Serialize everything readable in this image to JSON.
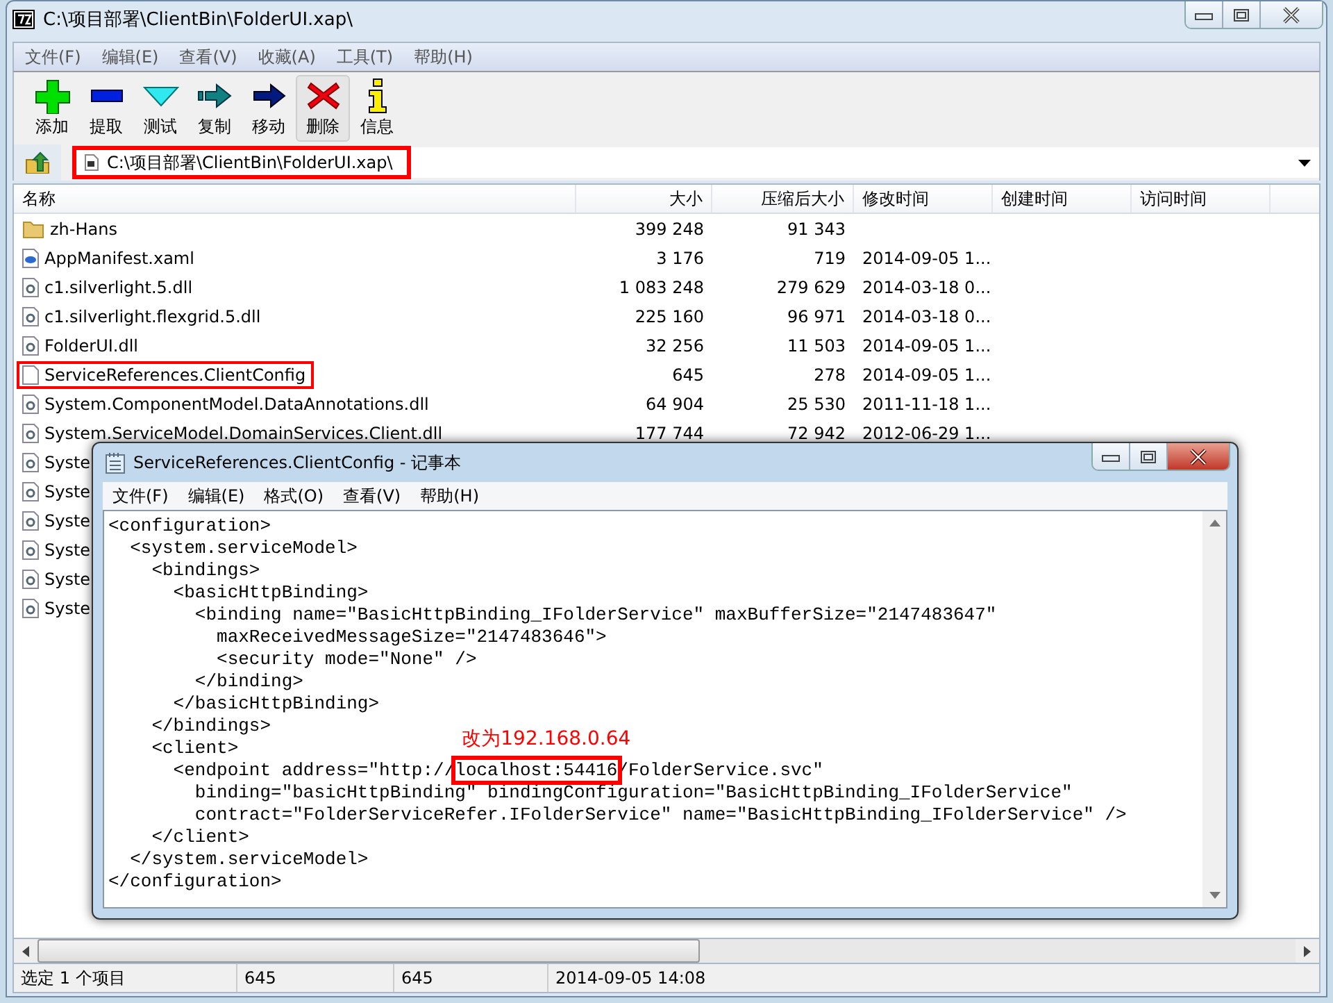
{
  "window": {
    "title": "C:\\项目部署\\ClientBin\\FolderUI.xap\\"
  },
  "menu": [
    "文件(F)",
    "编辑(E)",
    "查看(V)",
    "收藏(A)",
    "工具(T)",
    "帮助(H)"
  ],
  "toolbar": [
    {
      "kind": "add",
      "label": "添加",
      "hot": false
    },
    {
      "kind": "extract",
      "label": "提取",
      "hot": false
    },
    {
      "kind": "test",
      "label": "测试",
      "hot": false
    },
    {
      "kind": "copy",
      "label": "复制",
      "hot": false
    },
    {
      "kind": "move",
      "label": "移动",
      "hot": false
    },
    {
      "kind": "delete",
      "label": "删除",
      "hot": true
    },
    {
      "kind": "info",
      "label": "信息",
      "hot": false
    }
  ],
  "address": {
    "value": "C:\\项目部署\\ClientBin\\FolderUI.xap\\",
    "marked": true
  },
  "table": {
    "columns": [
      "名称",
      "大小",
      "压缩后大小",
      "修改时间",
      "创建时间",
      "访问时间"
    ],
    "rows": [
      {
        "kind": "folder",
        "name": "zh-Hans",
        "size": "399 248",
        "packed": "91 343",
        "modified": "",
        "marked": false
      },
      {
        "kind": "xaml",
        "name": "AppManifest.xaml",
        "size": "3 176",
        "packed": "719",
        "modified": "2014-09-05 1...",
        "marked": false
      },
      {
        "kind": "dll",
        "name": "c1.silverlight.5.dll",
        "size": "1 083 248",
        "packed": "279 629",
        "modified": "2014-03-18 0...",
        "marked": false
      },
      {
        "kind": "dll",
        "name": "c1.silverlight.flexgrid.5.dll",
        "size": "225 160",
        "packed": "96 971",
        "modified": "2014-03-18 0...",
        "marked": false
      },
      {
        "kind": "dll",
        "name": "FolderUI.dll",
        "size": "32 256",
        "packed": "11 503",
        "modified": "2014-09-05 1...",
        "marked": false
      },
      {
        "kind": "file",
        "name": "ServiceReferences.ClientConfig",
        "size": "645",
        "packed": "278",
        "modified": "2014-09-05 1...",
        "marked": true
      },
      {
        "kind": "dll",
        "name": "System.ComponentModel.DataAnnotations.dll",
        "size": "64 904",
        "packed": "25 530",
        "modified": "2011-11-18 1...",
        "marked": false
      },
      {
        "kind": "dll",
        "name": "System.ServiceModel.DomainServices.Client.dll",
        "size": "177 744",
        "packed": "72 942",
        "modified": "2012-06-29 1...",
        "marked": false
      },
      {
        "kind": "dll",
        "name": "Syste",
        "size": "",
        "packed": "",
        "modified": "",
        "marked": false
      },
      {
        "kind": "dll",
        "name": "Syste",
        "size": "",
        "packed": "",
        "modified": "",
        "marked": false
      },
      {
        "kind": "dll",
        "name": "Syste",
        "size": "",
        "packed": "",
        "modified": "",
        "marked": false
      },
      {
        "kind": "dll",
        "name": "Syste",
        "size": "",
        "packed": "",
        "modified": "",
        "marked": false
      },
      {
        "kind": "dll",
        "name": "Syste",
        "size": "",
        "packed": "",
        "modified": "",
        "marked": false
      },
      {
        "kind": "dll",
        "name": "Syste",
        "size": "",
        "packed": "",
        "modified": "",
        "marked": false
      }
    ]
  },
  "status_bar": [
    "选定 1 个项目",
    "645",
    "645",
    "2014-09-05 14:08"
  ],
  "notepad": {
    "title": "ServiceReferences.ClientConfig - 记事本",
    "menu": [
      "文件(F)",
      "编辑(E)",
      "格式(O)",
      "查看(V)",
      "帮助(H)"
    ],
    "annotation": "改为192.168.0.64",
    "lines": [
      {
        "kind": "plain",
        "text": "<configuration>"
      },
      {
        "kind": "plain",
        "text": "  <system.serviceModel>"
      },
      {
        "kind": "plain",
        "text": "    <bindings>"
      },
      {
        "kind": "plain",
        "text": "      <basicHttpBinding>"
      },
      {
        "kind": "plain",
        "text": "        <binding name=\"BasicHttpBinding_IFolderService\" maxBufferSize=\"2147483647\""
      },
      {
        "kind": "plain",
        "text": "          maxReceivedMessageSize=\"2147483646\">"
      },
      {
        "kind": "plain",
        "text": "          <security mode=\"None\" />"
      },
      {
        "kind": "plain",
        "text": "        </binding>"
      },
      {
        "kind": "plain",
        "text": "      </basicHttpBinding>"
      },
      {
        "kind": "plain",
        "text": "    </bindings>"
      },
      {
        "kind": "plain",
        "text": "    <client>"
      },
      {
        "kind": "marked",
        "before": "      <endpoint address=\"http://",
        "marked": "localhost:54416",
        "after": "/FolderService.svc\""
      },
      {
        "kind": "plain",
        "text": "        binding=\"basicHttpBinding\" bindingConfiguration=\"BasicHttpBinding_IFolderService\""
      },
      {
        "kind": "plain",
        "text": "        contract=\"FolderServiceRefer.IFolderService\" name=\"BasicHttpBinding_IFolderService\" />"
      },
      {
        "kind": "plain",
        "text": "    </client>"
      },
      {
        "kind": "plain",
        "text": "  </system.serviceModel>"
      },
      {
        "kind": "plain",
        "text": "</configuration>"
      }
    ]
  }
}
